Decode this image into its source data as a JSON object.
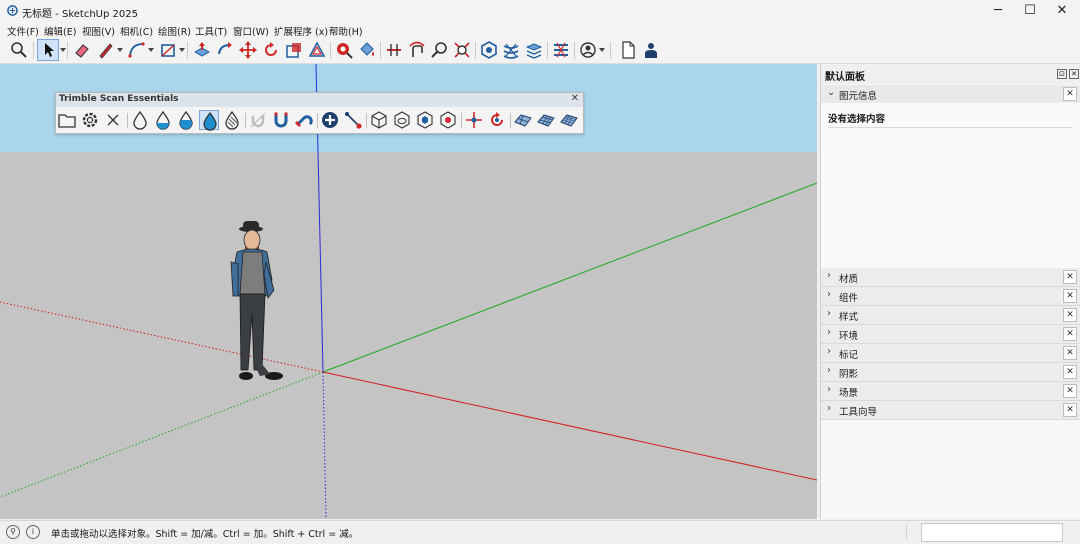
{
  "window": {
    "title": "无标题 - SketchUp 2025",
    "controls": [
      "─",
      "☐",
      "✕"
    ]
  },
  "menu": [
    "文件(F)",
    "编辑(E)",
    "视图(V)",
    "相机(C)",
    "绘图(R)",
    "工具(T)",
    "窗口(W)",
    "扩展程序 (x)",
    "帮助(H)"
  ],
  "toolbar": {
    "tools": [
      {
        "name": "zoom-icon"
      },
      {
        "name": "select-arrow-icon",
        "selected": true
      },
      {
        "name": "eraser-icon"
      },
      {
        "name": "pencil-line-icon"
      },
      {
        "name": "arc-icon"
      },
      {
        "name": "rectangle-icon"
      },
      {
        "name": "push-pull-icon"
      },
      {
        "name": "follow-me-icon"
      },
      {
        "name": "move-icon"
      },
      {
        "name": "rotate-icon"
      },
      {
        "name": "scale-icon"
      },
      {
        "name": "offset-icon"
      },
      {
        "name": "tape-measure-icon"
      },
      {
        "name": "paint-bucket-icon"
      },
      {
        "name": "section-plane-icon"
      },
      {
        "name": "orbit-icon"
      },
      {
        "name": "zoom-window-icon"
      },
      {
        "name": "zoom-extents-icon"
      },
      {
        "name": "components-icon"
      },
      {
        "name": "sandbox-icon"
      },
      {
        "name": "layers-icon"
      },
      {
        "name": "tags-icon"
      },
      {
        "name": "user-account-icon"
      },
      {
        "name": "new-file-icon"
      },
      {
        "name": "person-icon"
      }
    ]
  },
  "scan_panel": {
    "title": "Trimble Scan Essentials",
    "close": "✕"
  },
  "tray": {
    "title": "默认面板",
    "entity_info": {
      "label": "图元信息",
      "empty_text": "没有选择内容"
    },
    "sections": [
      "材质",
      "组件",
      "样式",
      "环境",
      "标记",
      "阴影",
      "场景",
      "工具向导"
    ]
  },
  "status": {
    "message": "单击或拖动以选择对象。Shift = 加/减。Ctrl = 加。Shift + Ctrl = 减。"
  },
  "colors": {
    "sky": "#a9d6ec",
    "ground": "#c4c4c4",
    "axis_red": "#d02020",
    "axis_green": "#1fa81f",
    "axis_blue": "#2a2ad8",
    "accent_selected": "#cfe3f8",
    "icon_blue": "#1f5f9f",
    "icon_red": "#d02828"
  }
}
